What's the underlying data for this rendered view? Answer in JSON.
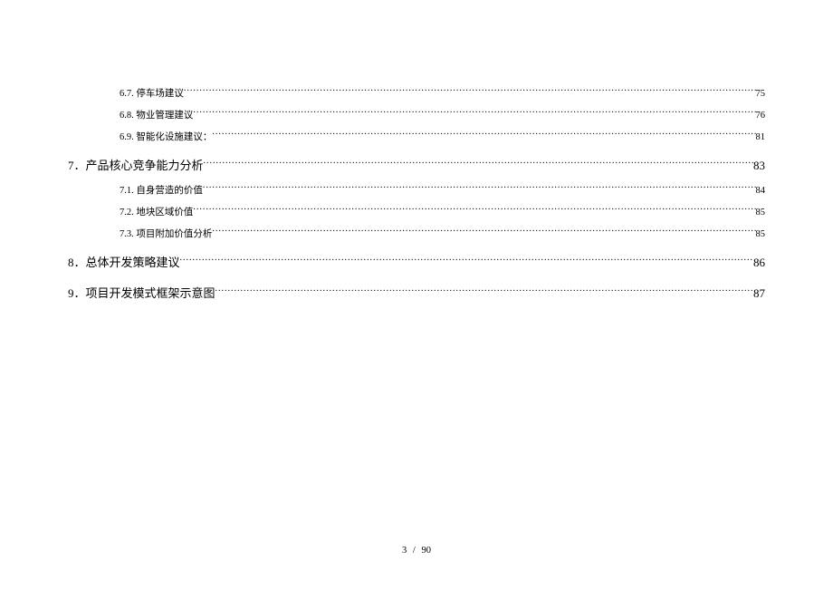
{
  "toc": {
    "sub_items_pre": [
      {
        "num": "6.7.",
        "title": "停车场建议",
        "page": "75"
      },
      {
        "num": "6.8.",
        "title": "物业管理建议",
        "page": "76"
      },
      {
        "num": "6.9.",
        "title": "智能化设施建议：",
        "page": "81"
      }
    ],
    "section7": {
      "num": "7．",
      "title": "产品核心竞争能力分析",
      "page": "83"
    },
    "section7_items": [
      {
        "num": "7.1.",
        "title": "自身营造的价值",
        "page": "84"
      },
      {
        "num": "7.2.",
        "title": "地块区域价值",
        "page": "85"
      },
      {
        "num": "7.3.",
        "title": "项目附加价值分析",
        "page": "85"
      }
    ],
    "section8": {
      "num": "8．",
      "title": "总体开发策略建议",
      "page": "86"
    },
    "section9": {
      "num": "9．",
      "title": "项目开发模式框架示意图",
      "page": "87"
    }
  },
  "footer": {
    "current_page": "3",
    "separator": "/",
    "total_pages": "90"
  }
}
